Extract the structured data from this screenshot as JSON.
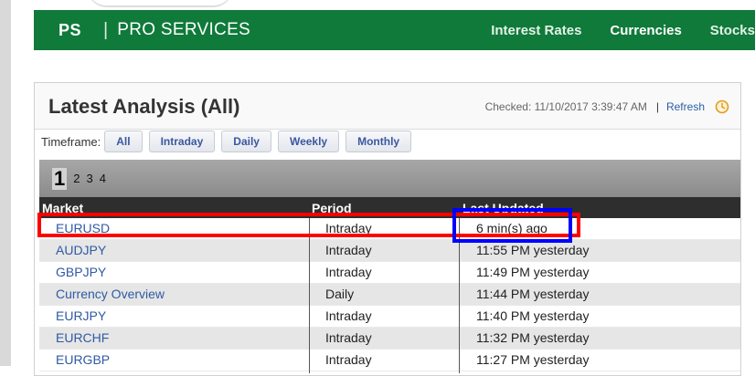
{
  "nav": {
    "logo": "PS",
    "separator": "|",
    "brand": "PRO SERVICES",
    "links": [
      {
        "label": "Interest Rates",
        "active": false
      },
      {
        "label": "Currencies",
        "active": true
      },
      {
        "label": "Stocks",
        "active": false
      }
    ]
  },
  "panel": {
    "title": "Latest Analysis (All)",
    "checked": "Checked: 11/10/2017 3:39:47 AM",
    "divider": "|",
    "refresh": "Refresh"
  },
  "timeframe": {
    "label": "Timeframe:",
    "buttons": [
      "All",
      "Intraday",
      "Daily",
      "Weekly",
      "Monthly"
    ]
  },
  "pager": {
    "current": "1",
    "pages": [
      "2",
      "3",
      "4"
    ]
  },
  "table": {
    "headers": [
      "Market",
      "Period",
      "Last Updated"
    ],
    "rows": [
      {
        "market": "EURUSD",
        "period": "Intraday",
        "updated": "6 min(s) ago"
      },
      {
        "market": "AUDJPY",
        "period": "Intraday",
        "updated": "11:55 PM yesterday"
      },
      {
        "market": "GBPJPY",
        "period": "Intraday",
        "updated": "11:49 PM yesterday"
      },
      {
        "market": "Currency Overview",
        "period": "Daily",
        "updated": "11:44 PM yesterday"
      },
      {
        "market": "EURJPY",
        "period": "Intraday",
        "updated": "11:40 PM yesterday"
      },
      {
        "market": "EURCHF",
        "period": "Intraday",
        "updated": "11:32 PM yesterday"
      },
      {
        "market": "EURGBP",
        "period": "Intraday",
        "updated": "11:27 PM yesterday"
      }
    ]
  },
  "colors": {
    "nav_green": "#0f7a3a",
    "link_blue": "#2f5aa3",
    "highlight_red": "#ff0000",
    "highlight_blue": "#0000ff",
    "clock_orange": "#e39b1c"
  }
}
